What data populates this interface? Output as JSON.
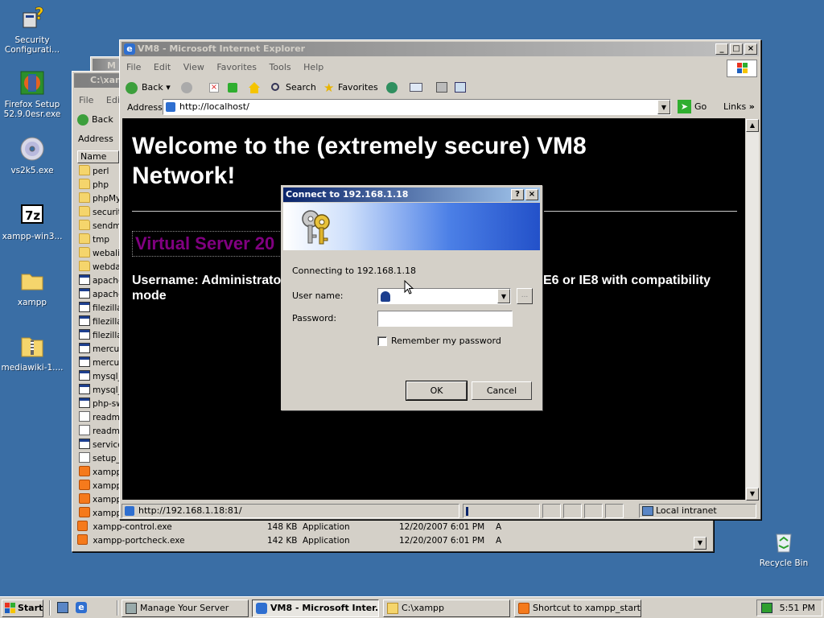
{
  "desktop": {
    "icons": [
      {
        "label": "Security Configurati...",
        "icon": "security-config-icon"
      },
      {
        "label": "Firefox Setup 52.9.0esr.exe",
        "icon": "firefox-setup-icon"
      },
      {
        "label": "vs2k5.exe",
        "icon": "cd-disc-icon"
      },
      {
        "label": "xampp-win3...",
        "icon": "7zip-icon"
      },
      {
        "label": "xampp",
        "icon": "folder-icon"
      },
      {
        "label": "mediawiki-1....",
        "icon": "zip-folder-icon"
      },
      {
        "label": "Recycle Bin",
        "icon": "recycle-bin-icon"
      }
    ]
  },
  "explorer": {
    "title": "C:\\xamp",
    "menu": [
      "File",
      "Edi"
    ],
    "back_label": "Back",
    "address_label": "Address",
    "column_name": "Name",
    "files": [
      "perl",
      "php",
      "phpMy",
      "securit",
      "sendm",
      "tmp",
      "webaliz",
      "webda",
      "apache",
      "apache",
      "filezilla_",
      "filezilla",
      "filezilla",
      "mercur",
      "mercur",
      "mysql_",
      "mysql_",
      "php-sw",
      "readme",
      "readme",
      "service",
      "setup_",
      "xampp",
      "xampp",
      "xampp",
      "xampp"
    ],
    "bottom_rows": [
      {
        "name": "xampp-control.exe",
        "size": "148 KB",
        "type": "Application",
        "modified": "12/20/2007 6:01 PM",
        "attr": "A"
      },
      {
        "name": "xampp-portcheck.exe",
        "size": "142 KB",
        "type": "Application",
        "modified": "12/20/2007 6:01 PM",
        "attr": "A"
      }
    ]
  },
  "manage_window": {
    "title": "M"
  },
  "ie": {
    "title": "VM8 - Microsoft Internet Explorer",
    "menu": [
      "File",
      "Edit",
      "View",
      "Favorites",
      "Tools",
      "Help"
    ],
    "toolbar": {
      "back": "Back",
      "search": "Search",
      "favorites": "Favorites"
    },
    "address_label": "Address",
    "url": "http://localhost/",
    "go_label": "Go",
    "links_label": "Links",
    "page": {
      "heading": "Welcome to the (extremely secure) VM8 Network!",
      "subtitle": "Virtual Server 20",
      "body_left": "Username: Administrato",
      "body_right": "E6 or IE8 with compatibility",
      "body_line2": "mode"
    },
    "status_url": "http://192.168.1.18:81/",
    "status_zone": "Local intranet"
  },
  "dialog": {
    "title": "Connect to 192.168.1.18",
    "connecting_text": "Connecting to 192.168.1.18",
    "username_label": "User name:",
    "username_value": "",
    "password_label": "Password:",
    "password_value": "",
    "remember_label": "Remember my password",
    "remember_checked": false,
    "ok_label": "OK",
    "cancel_label": "Cancel",
    "help_glyph": "?",
    "browse_glyph": "..."
  },
  "taskbar": {
    "start_label": "Start",
    "tasks": [
      {
        "label": "Manage Your Server",
        "pressed": false
      },
      {
        "label": "VM8 - Microsoft Inter...",
        "pressed": true
      },
      {
        "label": "C:\\xampp",
        "pressed": false
      },
      {
        "label": "Shortcut to xampp_start....",
        "pressed": false
      }
    ],
    "clock": "5:51 PM"
  }
}
